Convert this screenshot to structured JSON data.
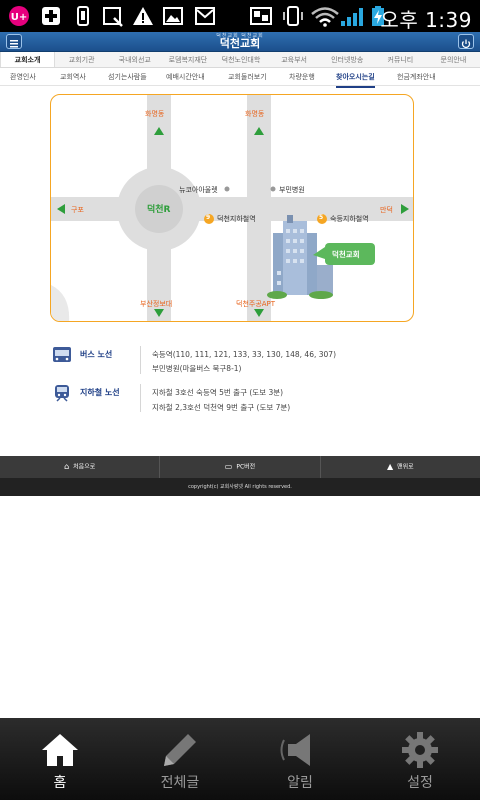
{
  "status_bar": {
    "time": "오후 1:39"
  },
  "title_bar": {
    "subtitle": "덕천교회 덕천교회",
    "title": "덕천교회"
  },
  "menu_primary": [
    "교회소개",
    "교회기관",
    "국내외선교",
    "로뎀복지재단",
    "덕천노인대학",
    "교육부서",
    "인터넷방송",
    "커뮤니티",
    "문의안내"
  ],
  "menu_secondary": [
    "환영인사",
    "교회역사",
    "섬기는사람들",
    "예배시간안내",
    "교회둘러보기",
    "차량운행",
    "찾아오시는길",
    "헌금계좌안내"
  ],
  "map": {
    "north_left": "화명동",
    "north_right": "화명동",
    "west": "구포",
    "east": "만덕",
    "roundabout": "덕천R",
    "outlet": "뉴코아아울렛",
    "hospital": "부민병원",
    "station_a_num": "9",
    "station_a": "덕천지하철역",
    "station_b_num": "5",
    "station_b": "숙등지하철역",
    "church": "덕천교회",
    "south_left": "부산정보대",
    "south_right": "덕천주공APT"
  },
  "bus": {
    "title": "버스 노선",
    "line1": "숙등역(110, 111, 121, 133, 33, 130, 148, 46, 307)",
    "line2": "부민병원(마을버스 북구8-1)"
  },
  "subway": {
    "title": "지하철 노선",
    "line1": "지하철 3호선 숙등역 5번 출구 (도보 3분)",
    "line2": "지하철 2,3호선 덕천역 9번 출구 (도보 7분)"
  },
  "footer": {
    "links": [
      "처음으로",
      "PC버전",
      "맨위로"
    ],
    "copyright": "copyright(c) 교회사랑넷 All rights reserved."
  },
  "bottom_nav": [
    {
      "label": "홈",
      "icon": "home-icon"
    },
    {
      "label": "전체글",
      "icon": "pencil-icon"
    },
    {
      "label": "알림",
      "icon": "speaker-icon"
    },
    {
      "label": "설정",
      "icon": "gear-icon"
    }
  ],
  "colors": {
    "title_blue": "#1f3f86",
    "accent_orange": "#e8621a",
    "road_gray": "#dedede",
    "label_green": "#2e9e3b"
  }
}
